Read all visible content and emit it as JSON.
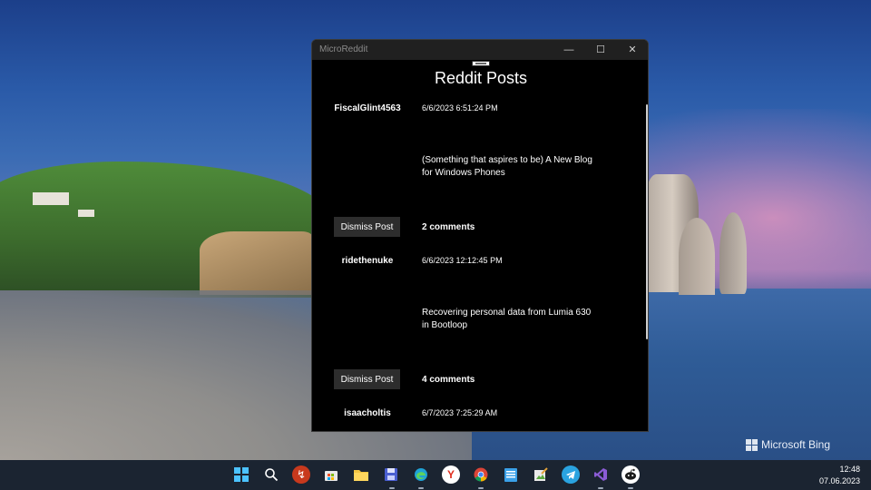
{
  "window": {
    "app_title": "MicroReddit",
    "controls": {
      "minimize": "—",
      "maximize": "☐",
      "close": "✕"
    }
  },
  "page_title": "Reddit Posts",
  "posts": [
    {
      "user": "FiscalGlint4563",
      "date": "6/6/2023 6:51:24 PM",
      "title": "(Something that aspires to be) A New Blog for Windows Phones",
      "dismiss_label": "Dismiss Post",
      "comments": "2 comments"
    },
    {
      "user": "ridethenuke",
      "date": "6/6/2023 12:12:45 PM",
      "title": "Recovering personal data from Lumia 630 in Bootloop",
      "dismiss_label": "Dismiss Post",
      "comments": "4 comments"
    },
    {
      "user": "isaacholtis",
      "date": "6/7/2023 7:25:29 AM"
    }
  ],
  "desktop": {
    "watermark": "Microsoft Bing"
  },
  "taskbar": {
    "icons": [
      "windows-start-icon",
      "search-icon",
      "remote-desktop-icon",
      "microsoft-store-icon",
      "file-explorer-icon",
      "save-app-icon",
      "edge-icon",
      "yandex-browser-icon",
      "chrome-icon",
      "notepad-icon",
      "paint-icon",
      "telegram-icon",
      "visual-studio-icon",
      "reddit-app-icon"
    ],
    "time": "12:48",
    "date": "07.06.2023"
  }
}
